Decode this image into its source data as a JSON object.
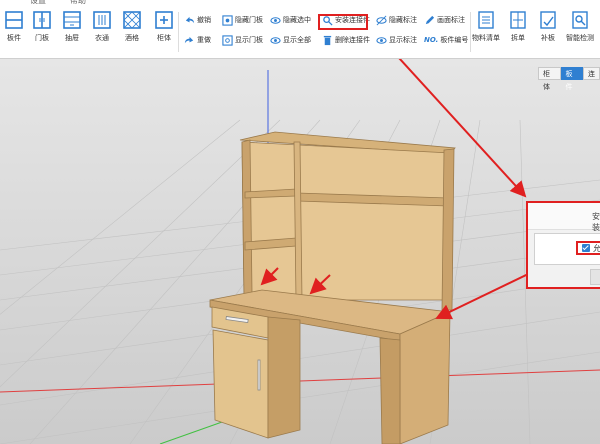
{
  "top_menu": [
    "设置",
    "帮助"
  ],
  "toolbar": {
    "big_left": [
      {
        "label": "板件",
        "icon": "panel-icon"
      },
      {
        "label": "门板",
        "icon": "door-panel-icon"
      },
      {
        "label": "抽屉",
        "icon": "drawer-icon"
      },
      {
        "label": "衣通",
        "icon": "wardrobe-rail-icon"
      },
      {
        "label": "酒格",
        "icon": "wine-rack-icon"
      },
      {
        "label": "柜体",
        "icon": "add-cabinet-icon"
      }
    ],
    "small_col1": [
      {
        "label": "撤销",
        "icon": "undo-icon"
      },
      {
        "label": "重做",
        "icon": "redo-icon"
      }
    ],
    "small_col2": [
      {
        "label": "隐藏门板",
        "icon": "hide-door-icon"
      },
      {
        "label": "显示门板",
        "icon": "show-door-icon"
      }
    ],
    "small_col3": [
      {
        "label": "隐藏选中",
        "icon": "eye-icon"
      },
      {
        "label": "显示全部",
        "icon": "eye-icon"
      }
    ],
    "small_col4": [
      {
        "label": "安装连接件",
        "icon": "connector-icon"
      },
      {
        "label": "删除连接件",
        "icon": "trash-icon"
      }
    ],
    "small_col5": [
      {
        "label": "隐藏标注",
        "icon": "hide-dimension-icon"
      },
      {
        "label": "显示标注",
        "icon": "show-dimension-icon"
      }
    ],
    "small_col6": [
      {
        "label": "画面标注",
        "icon": "pen-icon"
      },
      {
        "label": "板件编号",
        "prefix": "NO.",
        "icon": "number-icon"
      }
    ],
    "big_right": [
      {
        "label": "物料清单",
        "icon": "material-list-icon"
      },
      {
        "label": "拆单",
        "icon": "split-order-icon"
      },
      {
        "label": "补板",
        "icon": "patch-panel-icon"
      },
      {
        "label": "智能检测",
        "icon": "smart-check-icon"
      }
    ]
  },
  "view_tabs": [
    {
      "label": "柜体",
      "active": false
    },
    {
      "label": "板件",
      "active": true
    },
    {
      "label": "连",
      "active": false
    }
  ],
  "dialog": {
    "title": "安装",
    "checkbox_label": "允"
  },
  "colors": {
    "accent": "#2f7fd1",
    "highlight": "#e02020",
    "wood": "#e2bf8c",
    "floor": "#d9d9d9"
  }
}
